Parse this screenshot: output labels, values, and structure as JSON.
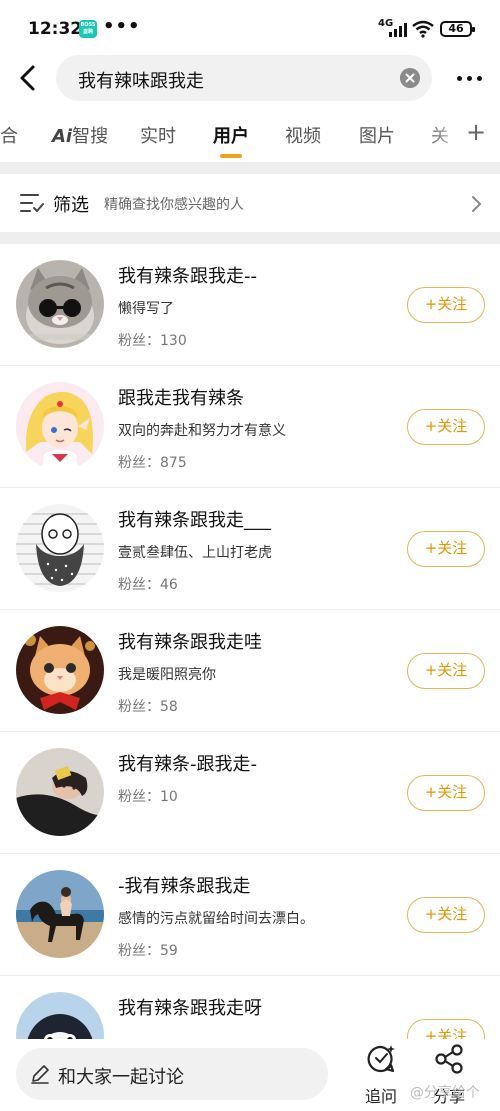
{
  "status_bar": {
    "time": "12:32",
    "app_badge": "BOSS直聘",
    "dots": "•••",
    "network": "4G",
    "battery": "46"
  },
  "search": {
    "query": "我有辣味跟我走"
  },
  "tabs": [
    {
      "label": "合"
    },
    {
      "label": "智搜",
      "prefix": "Ai"
    },
    {
      "label": "实时"
    },
    {
      "label": "用户",
      "active": true
    },
    {
      "label": "视频"
    },
    {
      "label": "图片"
    },
    {
      "label": "关"
    }
  ],
  "filter": {
    "title": "筛选",
    "subtitle": "精确查找你感兴趣的人"
  },
  "users": [
    {
      "name": "我有辣条跟我走--",
      "bio": "懒得写了",
      "fans": "粉丝：130",
      "avatar": "cat-sunglasses-avatar"
    },
    {
      "name": "跟我走我有辣条",
      "bio": "双向的奔赴和努力才有意义",
      "fans": "粉丝：875",
      "avatar": "anime-girl-avatar"
    },
    {
      "name": "我有辣条跟我走___",
      "bio": "壹贰叁肆伍、上山打老虎",
      "fans": "粉丝：46",
      "avatar": "bearded-man-sketch-avatar"
    },
    {
      "name": "我有辣条跟我走哇",
      "bio": "我是暖阳照亮你",
      "fans": "粉丝：58",
      "avatar": "orange-cat-avatar"
    },
    {
      "name": "我有辣条-跟我走-",
      "bio": "",
      "fans": "粉丝：10",
      "avatar": "person-lying-avatar"
    },
    {
      "name": "-我有辣条跟我走",
      "bio": "感情的污点就留给时间去漂白。",
      "fans": "粉丝：59",
      "avatar": "horse-beach-avatar"
    },
    {
      "name": "我有辣条跟我走呀",
      "bio": "",
      "fans": "",
      "avatar": "penguin-avatar"
    }
  ],
  "follow_label": "+关注",
  "bottom_bar": {
    "discuss_placeholder": "和大家一起讨论",
    "ask_label": "追问",
    "share_label": "分享",
    "watermark": "@分享给个"
  },
  "colors": {
    "accent": "#f0a21e",
    "follow_text": "#e59600",
    "follow_border": "#e7b458"
  }
}
